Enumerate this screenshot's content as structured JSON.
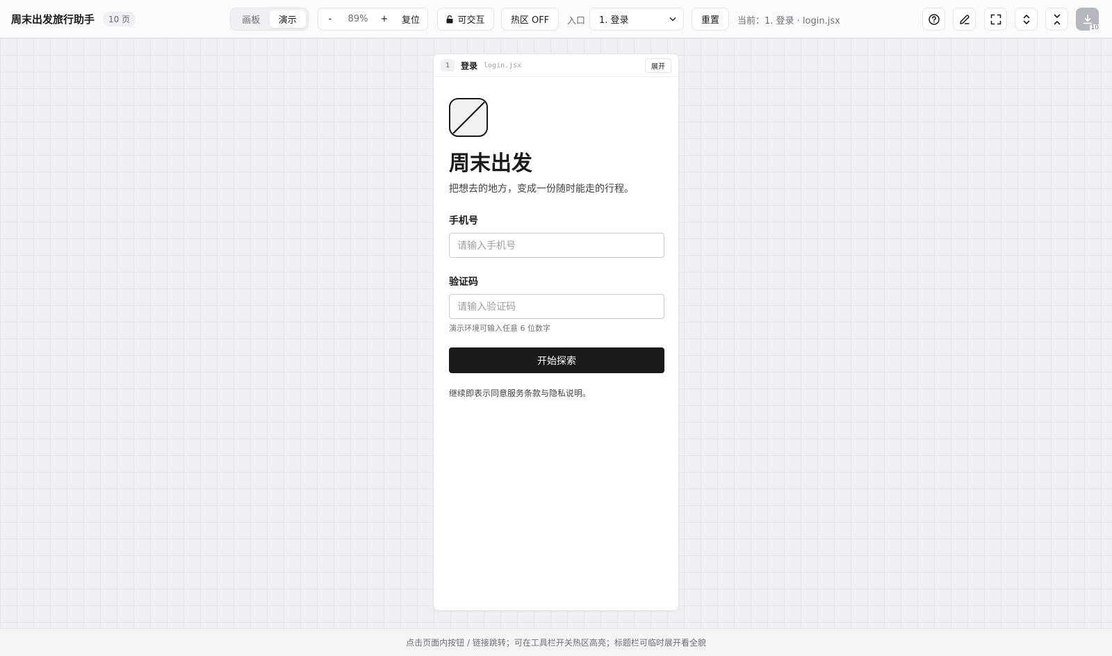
{
  "app": {
    "title": "周末出发旅行助手",
    "page_count": "10 页"
  },
  "toolbar": {
    "mode_tabs": [
      {
        "label": "画板",
        "active": false
      },
      {
        "label": "演示",
        "active": true
      }
    ],
    "zoom": {
      "minus": "-",
      "value": "89%",
      "plus": "+",
      "reset": "复位"
    },
    "interactive_label": "可交互",
    "hotspot_label": "热区 OFF",
    "entry_label": "入口",
    "entry_selected": "1. 登录",
    "reset_label": "重置",
    "current_path": "当前：1. 登录 · login.jsx",
    "icons": [
      "help-icon",
      "edit-icon",
      "fullscreen-icon",
      "expand-vertical-icon",
      "collapse-vertical-icon",
      "download-icon"
    ],
    "download_badge": "10"
  },
  "frame": {
    "number": "1",
    "name": "登录",
    "file": "login.jsx",
    "expand_label": "展开"
  },
  "login": {
    "title": "周末出发",
    "subtitle": "把想去的地方，变成一份随时能走的行程。",
    "phone_label": "手机号",
    "phone_placeholder": "请输入手机号",
    "code_label": "验证码",
    "code_placeholder": "请输入验证码",
    "hint": "演示环境可输入任意 6 位数字",
    "submit_label": "开始探索",
    "terms": "继续即表示同意服务条款与隐私说明。"
  },
  "footer": {
    "text": "点击页面内按钮 / 链接跳转；可在工具栏开关热区高亮；标题栏可临时展开看全貌"
  },
  "colors": {
    "primary": "#1a1a1a",
    "canvas": "#eef0f3",
    "muted_text": "#6b6f76"
  }
}
